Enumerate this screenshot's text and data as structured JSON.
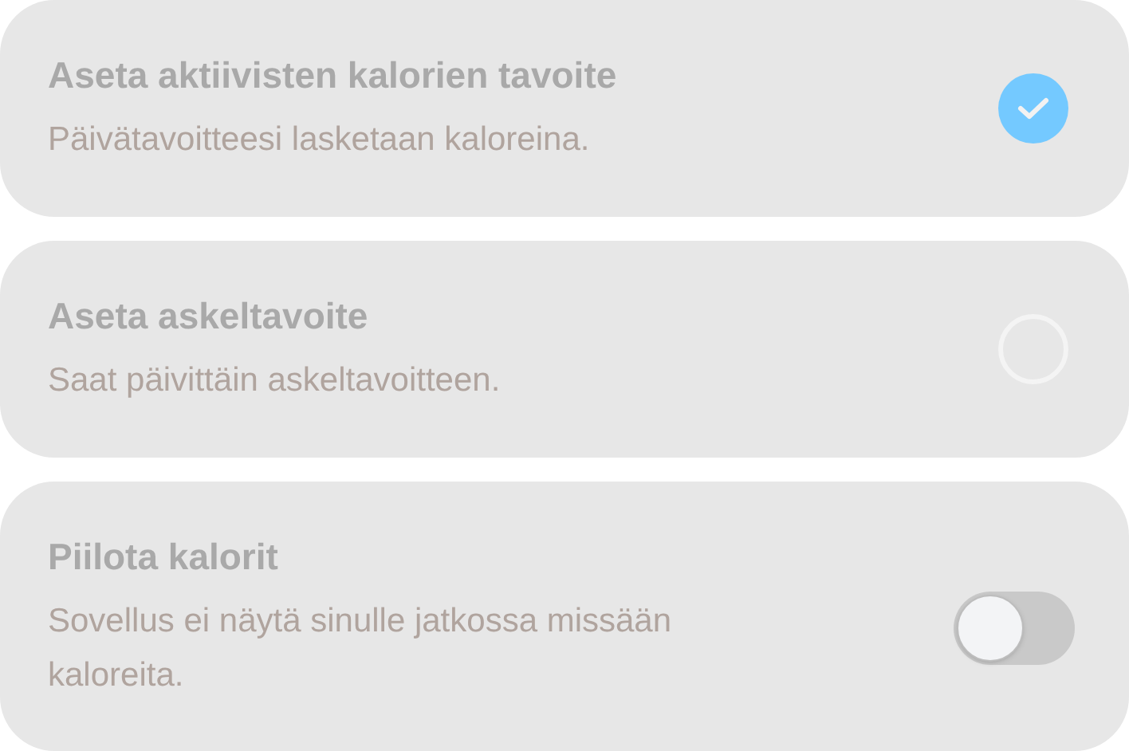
{
  "options": [
    {
      "kind": "radio",
      "title": "Aseta aktiivisten kalorien tavoite",
      "description": "Päivätavoitteesi lasketaan kaloreina.",
      "selected": true
    },
    {
      "kind": "radio",
      "title": "Aseta askeltavoite",
      "description": "Saat päivittäin askeltavoitteen.",
      "selected": false
    },
    {
      "kind": "switch",
      "title": "Piilota kalorit",
      "description": "Sovellus ei näytä sinulle jatkossa missään kaloreita.",
      "on": false
    }
  ]
}
